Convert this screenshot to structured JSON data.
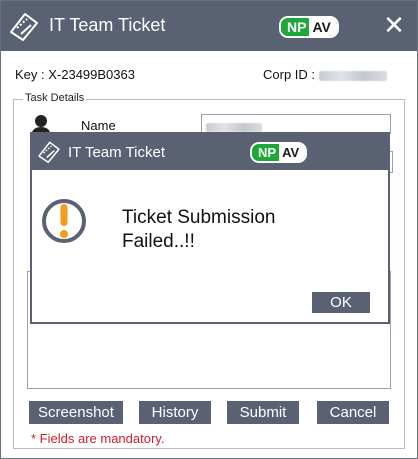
{
  "window": {
    "title": "IT Team Ticket",
    "badge_np": "NP",
    "badge_av": "AV",
    "close_glyph": "✕"
  },
  "info": {
    "key_text": "Key : X-23499B0363",
    "corp_label": "Corp ID :"
  },
  "form": {
    "legend": "Task Details",
    "name_label": "Name"
  },
  "buttons": {
    "screenshot": "Screenshot",
    "history": "History",
    "submit": "Submit",
    "cancel": "Cancel"
  },
  "mandatory_note": "*  Fields are mandatory.",
  "dialog": {
    "title": "IT Team Ticket",
    "badge_np": "NP",
    "badge_av": "AV",
    "message_line1": "Ticket Submission",
    "message_line2": "Failed..!!",
    "ok_label": "OK"
  },
  "colors": {
    "titlebar": "#5a6172",
    "badge_green": "#1fa83a",
    "warning_orange": "#f59a1b",
    "mandatory_red": "#d0202a"
  },
  "icons": {
    "ticket": "ticket-icon",
    "user": "user-icon",
    "warning": "warning-icon",
    "close": "close-icon"
  }
}
